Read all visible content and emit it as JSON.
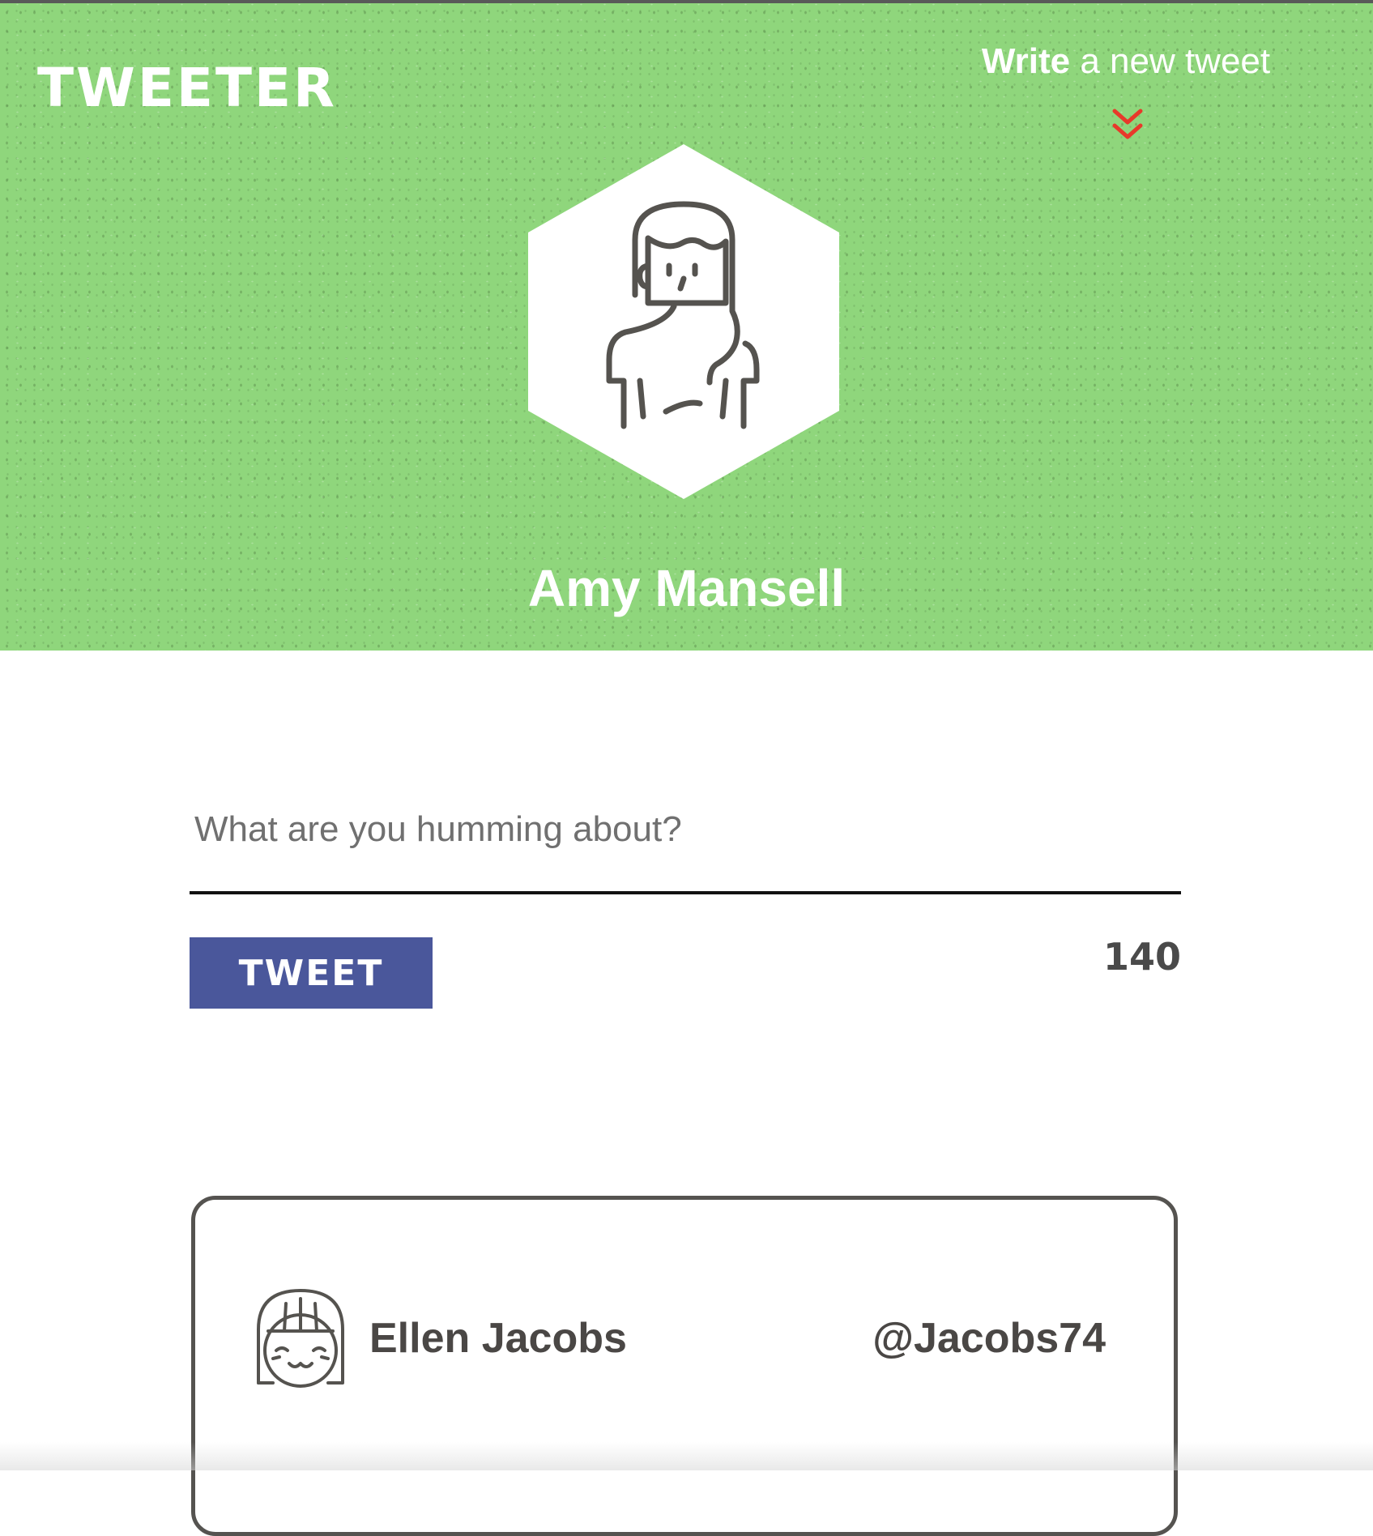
{
  "app": {
    "logo": "TWEETER"
  },
  "nav": {
    "write_bold": "Write",
    "write_rest": " a new tweet",
    "chevron_icon": "double-chevron-down-icon",
    "chevron_color": "#e8392a"
  },
  "profile": {
    "name": "Amy Mansell",
    "avatar_icon": "woman-avatar-icon"
  },
  "compose": {
    "placeholder": "What are you humming about?",
    "value": "",
    "button_label": "Tweet",
    "char_count": "140",
    "button_color": "#4a579b"
  },
  "tweets": [
    {
      "author": "Ellen Jacobs",
      "handle": "@Jacobs74",
      "avatar_icon": "smiling-girl-avatar-icon"
    }
  ],
  "colors": {
    "header_green": "#8fd67c",
    "dark_outline": "#555350"
  }
}
